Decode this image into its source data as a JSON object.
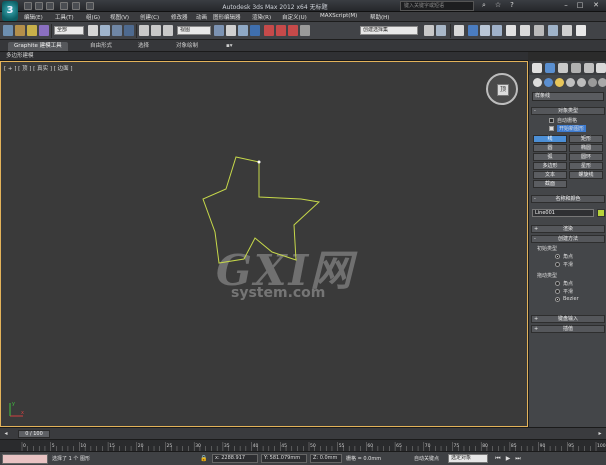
{
  "titlebar": {
    "logo": "3",
    "title": "Autodesk 3ds Max  2012 x64    无标题",
    "search_placeholder": "键入关键字或短语"
  },
  "menu": [
    "编辑(E)",
    "工具(T)",
    "组(G)",
    "视图(V)",
    "创建(C)",
    "修改器",
    "动画",
    "图形编辑器",
    "渲染(R)",
    "自定义(U)",
    "MAXScript(M)",
    "帮助(H)"
  ],
  "toolbar": {
    "selection_filter": "全部",
    "reference_coord": "视图",
    "named_selection": "创建选择集"
  },
  "ribbon": {
    "tabs": [
      "Graphite 建模工具",
      "自由形式",
      "选择",
      "对象绘制"
    ],
    "sub_label": "多边形建模"
  },
  "viewport": {
    "label": "[ + ] [ 顶 ] [ 真实 ] [ 边面 ]",
    "viewcube_face": "顶",
    "watermark_main": "GXI网",
    "watermark_url": "system.com",
    "axis_x": "x",
    "axis_y": "y",
    "shape_color": "#c6d84a"
  },
  "command_panel": {
    "dropdown": "样条线",
    "object_type": {
      "title": "对象类型",
      "auto_grid": "自动栅格",
      "start_new_shape": "开始新图形",
      "buttons": [
        "线",
        "矩形",
        "圆",
        "椭圆",
        "弧",
        "圆环",
        "多边形",
        "星形",
        "文本",
        "螺旋线",
        "截面"
      ],
      "active": "线"
    },
    "name_color": {
      "title": "名称和颜色",
      "name": "Line001",
      "color": "#b7d33b"
    },
    "rendering": {
      "title": "渲染"
    },
    "creation_method": {
      "title": "创建方法",
      "initial_type": "初始类型",
      "initial_options": [
        "角点",
        "平滑"
      ],
      "initial_selected": "角点",
      "drag_type": "拖动类型",
      "drag_options": [
        "角点",
        "平滑",
        "Bezier"
      ],
      "drag_selected": "Bezier"
    },
    "keyboard_entry": {
      "title": "键盘输入"
    },
    "interpolation": {
      "title": "插值"
    }
  },
  "timeline": {
    "slider": "0 / 100",
    "ticks": [
      "0",
      "5",
      "10",
      "15",
      "20",
      "25",
      "30",
      "35",
      "40",
      "45",
      "50",
      "55",
      "60",
      "65",
      "70",
      "75",
      "80",
      "85",
      "90",
      "95",
      "100"
    ]
  },
  "status": {
    "selected": "选择了 1 个 图形",
    "x": "x: 2288.917",
    "y": "Y: 581.079mm",
    "z": "Z: 0.0mm",
    "grid": "栅格 = 0.0mm",
    "auto_key": "自动关键点",
    "selected_dropdown": "选定对象"
  }
}
